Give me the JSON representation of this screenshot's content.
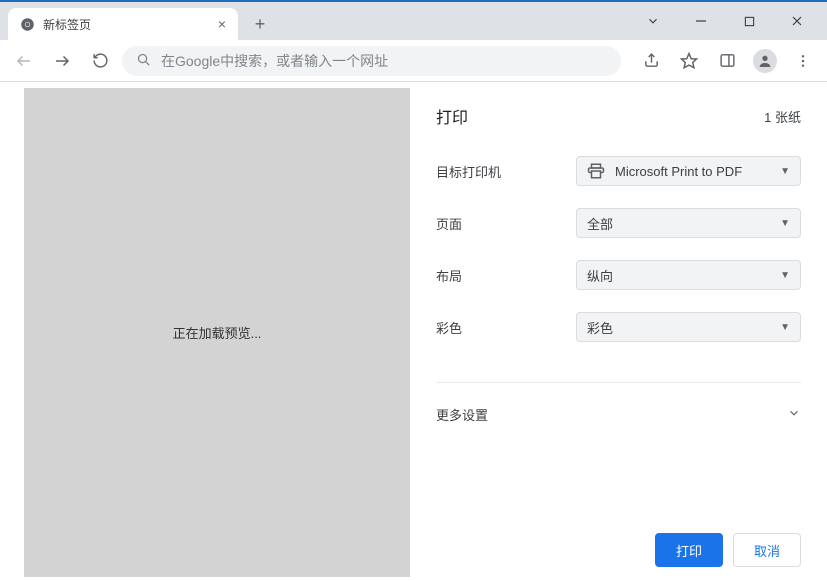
{
  "tab": {
    "title": "新标签页"
  },
  "omnibox": {
    "placeholder": "在Google中搜索，或者输入一个网址"
  },
  "preview": {
    "loading_text": "正在加载预览..."
  },
  "print": {
    "title": "打印",
    "sheet_count": "1 张纸",
    "destination_label": "目标打印机",
    "destination_value": "Microsoft Print to PDF",
    "pages_label": "页面",
    "pages_value": "全部",
    "layout_label": "布局",
    "layout_value": "纵向",
    "color_label": "彩色",
    "color_value": "彩色",
    "more_settings": "更多设置",
    "print_button": "打印",
    "cancel_button": "取消"
  }
}
